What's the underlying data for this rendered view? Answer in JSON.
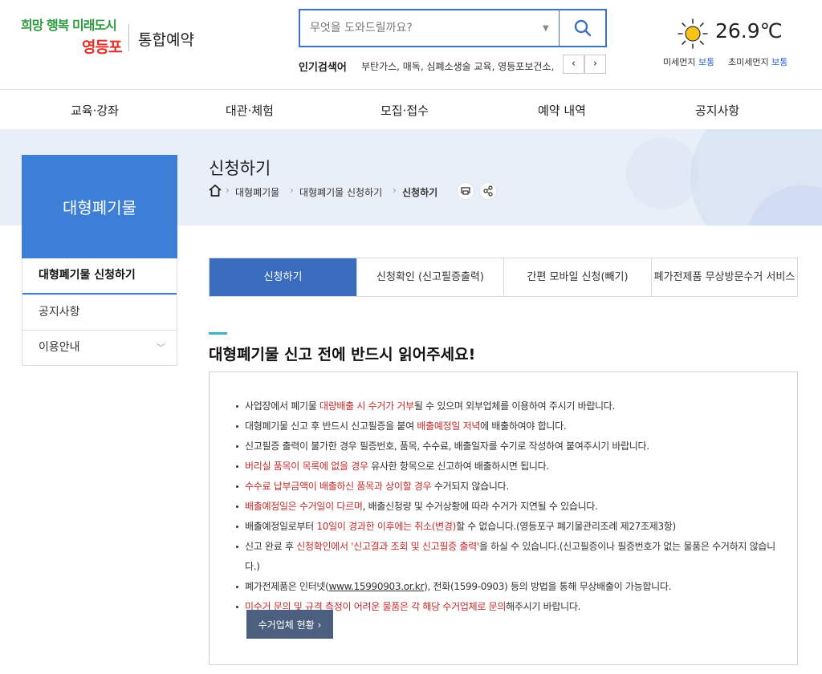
{
  "header": {
    "logo": {
      "line1": "희망 행복 미래도시",
      "line2": "영등포"
    },
    "service_title": "통합예약",
    "search": {
      "placeholder": "무엇을 도와드릴까요?"
    },
    "popular": {
      "label": "인기검색어",
      "terms": "부탄가스, 매독, 심폐소생술 교육, 영등포보건소, 하"
    },
    "weather": {
      "temperature": "26.9℃",
      "dust_label": "미세먼지",
      "dust_value": "보통",
      "fine_dust_label": "초미세먼지",
      "fine_dust_value": "보통"
    }
  },
  "nav": {
    "items": [
      "교육·강좌",
      "대관·체험",
      "모집·접수",
      "예약 내역",
      "공지사항"
    ]
  },
  "sidebar": {
    "title": "대형폐기물",
    "items": [
      {
        "label": "대형폐기물 신청하기"
      },
      {
        "label": "공지사항"
      },
      {
        "label": "이용안내",
        "chevron": "﹀"
      }
    ]
  },
  "page": {
    "title": "신청하기",
    "breadcrumb": [
      "대형폐기물",
      "대형폐기물 신청하기",
      "신청하기"
    ]
  },
  "tabs": [
    "신청하기",
    "신청확인 (신고필증출력)",
    "간편 모바일 신청(빼기)",
    "폐가전제품 무상방문수거 서비스"
  ],
  "notice": {
    "heading": "대형폐기물 신고 전에 반드시 읽어주세요!",
    "items": [
      {
        "t1": "사업장에서 폐기물 ",
        "e1": "대량배출 시 수거가 거부",
        "t2": "될 수 있으며 외부업체를 이용하여 주시기 바랍니다."
      },
      {
        "t1": "대형폐기물 신고 후 반드시 신고필증을 붙여 ",
        "e1": "배출예정일 저녁",
        "t2": "에 배출하여야 합니다."
      },
      {
        "t1": "신고필증 출력이 불가한 경우 필증번호, 품목, 수수료, 배출일자를 수기로 작성하여 붙여주시기 바랍니다."
      },
      {
        "e1": "버리실 품목이 목록에 없을 경우",
        "t2": " 유사한 항목으로 신고하여 배출하시면 됩니다."
      },
      {
        "e1": "수수료 납부금액이 배출하신 품목과 상이할 경우",
        "t2": " 수거되지 않습니다."
      },
      {
        "e1": "배출예정일은 수거일이 다르며",
        "t2": ", 배출신청량 및 수거상황에 따라 수거가 지연될 수 있습니다."
      },
      {
        "t1": "배출예정일로부터 ",
        "e1": "10일이 경과한 이후에는 취소(변경)",
        "t2": "할 수 없습니다.(영등포구 폐기물관리조례 제27조제3항)"
      },
      {
        "t1": "신고 완료 후 ",
        "e1": "신청확인에서 '신고결과 조회 및 신고필증 출력'",
        "t2": "을 하실 수 있습니다.(신고필증이나 필증번호가 없는 물품은 수거하지 않습니다.)"
      },
      {
        "t1": "폐가전제품은 인터넷(",
        "link": "www.15990903.or.kr",
        "t2": "), 전화(1599-0903) 등의 방법을 통해 무상배출이 가능합니다."
      },
      {
        "e1": "미수거 문의 및 규격 측정이 어려운 물품은 각 해당 수거업체로 문의",
        "t2": "해주시기 바랍니다."
      }
    ],
    "vendor_button": "수거업체 현황"
  },
  "colors": {
    "primary": "#3a6cbd",
    "sidebar": "#3d7fd6",
    "accent_red": "#c02c2c",
    "banner_bg": "#e9eff8"
  }
}
